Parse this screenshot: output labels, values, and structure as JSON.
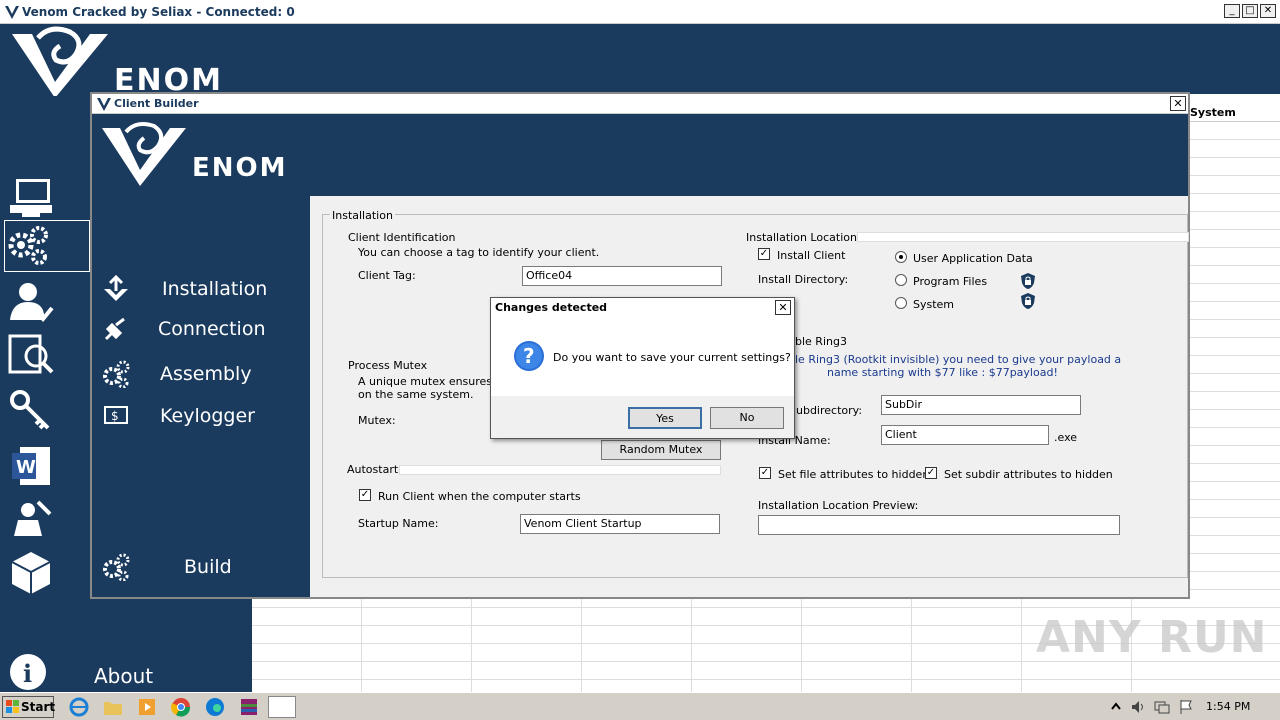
{
  "main_window": {
    "title": "Venom Cracked by Seliax - Connected: 0",
    "brand": "ENOM",
    "column_header_system": "System",
    "about_label": "About",
    "window_buttons": [
      "_",
      "□",
      "✕"
    ]
  },
  "client_builder": {
    "title": "Client Builder",
    "close": "✕",
    "brand": "ENOM",
    "nav": {
      "installation": "Installation",
      "connection": "Connection",
      "assembly": "Assembly",
      "keylogger": "Keylogger",
      "build": "Build"
    },
    "installation_group": "Installation",
    "client_identification": {
      "heading": "Client Identification",
      "hint": "You can choose a tag to identify your client.",
      "tag_label": "Client Tag:",
      "tag_value": "Office04"
    },
    "process_mutex": {
      "heading": "Process Mutex",
      "hint_line1": "A unique mutex ensures t",
      "hint_line2": "on the same system.",
      "mutex_label": "Mutex:",
      "random_button": "Random Mutex"
    },
    "autostart": {
      "heading": "Autostart",
      "run_on_start_label": "Run Client when the computer starts",
      "run_on_start_checked": true,
      "startup_name_label": "Startup Name:",
      "startup_name_value": "Venom Client Startup"
    },
    "installation_location": {
      "heading": "Installation Location",
      "install_client_label": "Install Client",
      "install_client_checked": true,
      "install_dir_label": "Install Directory:",
      "options": [
        "User Application Data",
        "Program Files",
        "System"
      ],
      "selected_option": "User Application Data",
      "ring3_heading": "ble Ring3",
      "ring3_note_line1": "le Ring3 (Rootkit invisible)  you need to give your payload a",
      "ring3_note_line2": "name starting with $77 like : $77payload!",
      "subdir_label": "ubdirectory:",
      "subdir_value": "SubDir",
      "install_name_label": "Install Name:",
      "install_name_value": "Client",
      "ext": ".exe",
      "hide_file_label": "Set file attributes to hidden",
      "hide_file_checked": true,
      "hide_subdir_label": "Set subdir attributes to hidden",
      "hide_subdir_checked": true,
      "preview_label": "Installation Location Preview:",
      "preview_value": ""
    }
  },
  "dialog": {
    "title": "Changes detected",
    "close": "✕",
    "message": "Do you want to save your current settings?",
    "yes": "Yes",
    "no": "No"
  },
  "taskbar": {
    "start": "Start",
    "clock": "1:54 PM"
  },
  "watermark": "ANY RUN",
  "colors": {
    "panel_navy": "#1a3a5e",
    "dialog_bg": "#f0f0f0",
    "note_blue": "#1a3a8e"
  }
}
